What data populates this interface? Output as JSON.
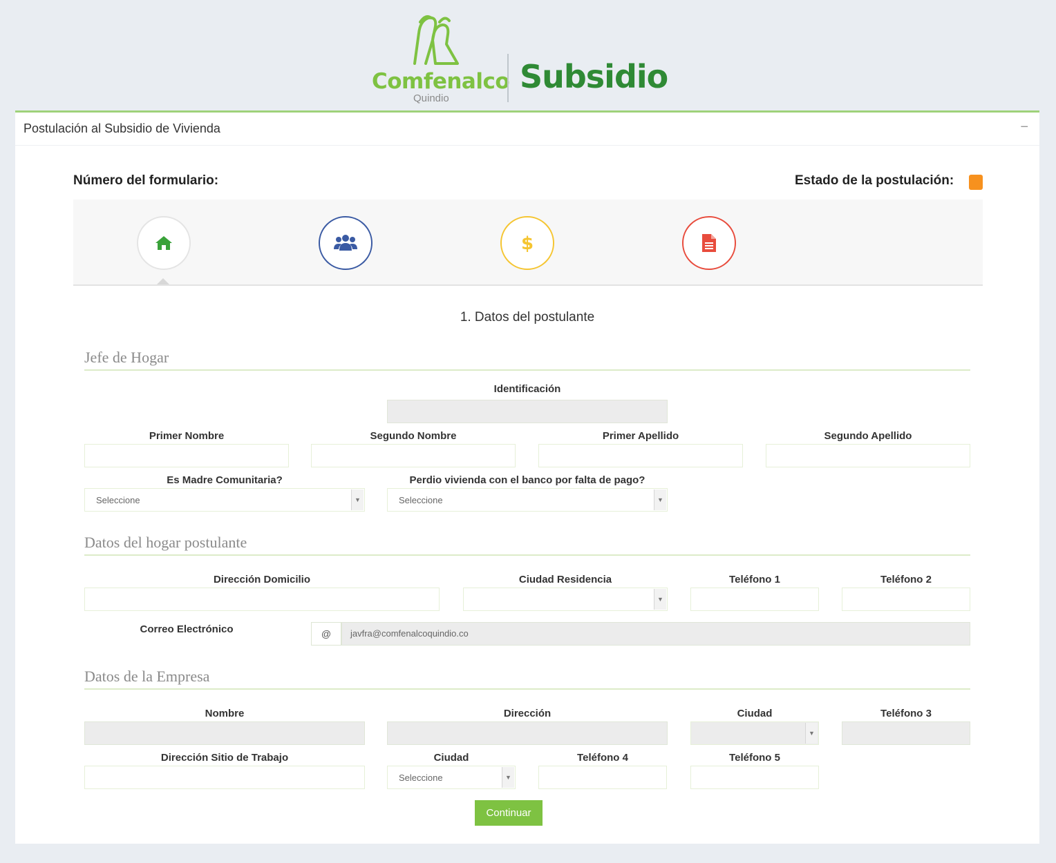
{
  "brand": {
    "name": "Comfenalco",
    "region": "Quindio",
    "product": "Subsidio",
    "colors": {
      "green": "#7ec242",
      "dark_green": "#2f8a35"
    }
  },
  "panel": {
    "title": "Postulación al Subsidio de Vivienda",
    "collapse_label": "−"
  },
  "form_number_label": "Número del formulario:",
  "status_label": "Estado de la postulación:",
  "status_color": "#f7911e",
  "wizard": {
    "steps": [
      {
        "icon": "home-icon",
        "color": "#3aa23a",
        "active": true
      },
      {
        "icon": "users-icon",
        "color": "#3a5aa3"
      },
      {
        "icon": "dollar-icon",
        "color": "#f5c531"
      },
      {
        "icon": "document-icon",
        "color": "#e84c3d"
      }
    ]
  },
  "step_title": "1. Datos del postulante",
  "sections": {
    "jefe": "Jefe de Hogar",
    "hogar": "Datos del hogar postulante",
    "empresa": "Datos de la Empresa"
  },
  "fields": {
    "identificacion": "Identificación",
    "primer_nombre": "Primer Nombre",
    "segundo_nombre": "Segundo Nombre",
    "primer_apellido": "Primer Apellido",
    "segundo_apellido": "Segundo Apellido",
    "madre_comunitaria": "Es Madre Comunitaria?",
    "perdio_vivienda": "Perdio vivienda con el banco por falta de pago?",
    "direccion_domicilio": "Dirección Domicilio",
    "ciudad_residencia": "Ciudad Residencia",
    "telefono1": "Teléfono 1",
    "telefono2": "Teléfono 2",
    "correo": "Correo Electrónico",
    "correo_value": "javfra@comfenalcoquindio.co",
    "correo_addon": "@",
    "empresa_nombre": "Nombre",
    "empresa_direccion": "Dirección",
    "empresa_ciudad": "Ciudad",
    "telefono3": "Teléfono 3",
    "direccion_trabajo": "Dirección Sitio de Trabajo",
    "trabajo_ciudad": "Ciudad",
    "telefono4": "Teléfono 4",
    "telefono5": "Teléfono 5"
  },
  "select_placeholder": "Seleccione",
  "continue_label": "Continuar"
}
